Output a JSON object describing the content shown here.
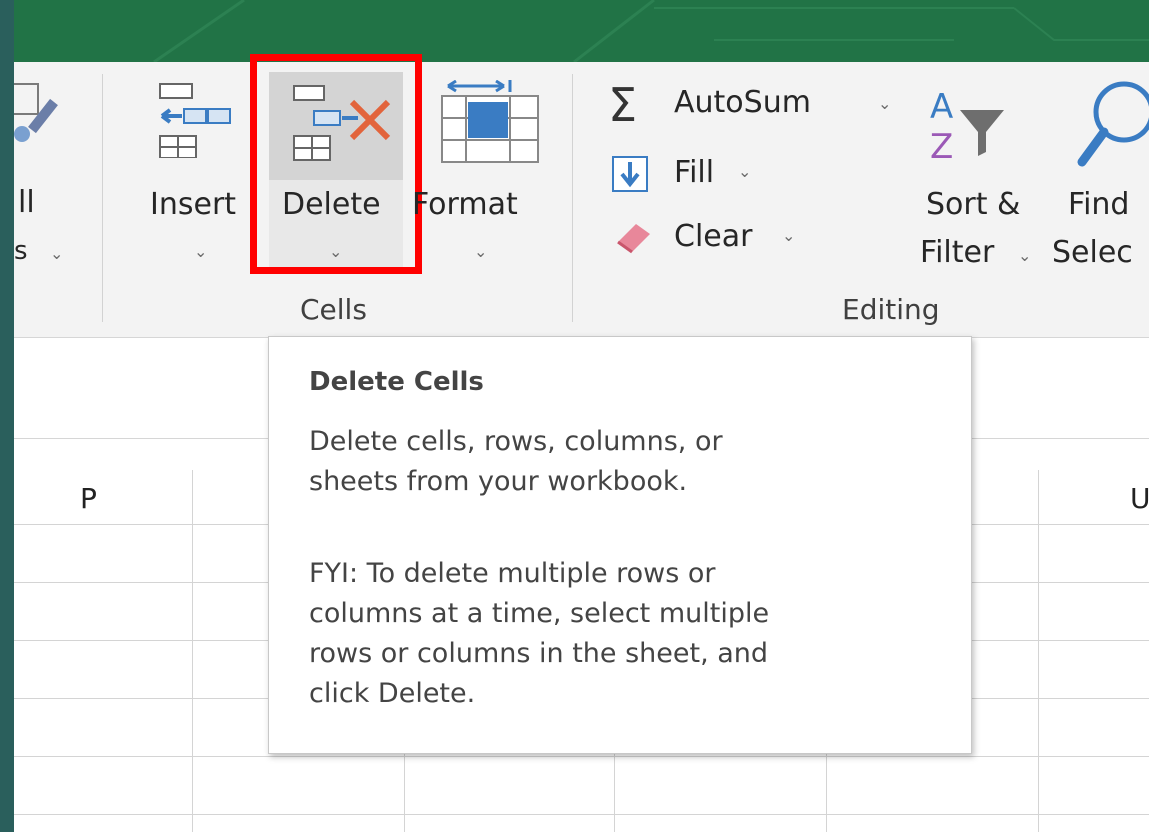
{
  "ribbon": {
    "left_partial": {
      "label_line1": "ll",
      "label_line2": "s"
    },
    "cells_group": {
      "label": "Cells",
      "insert": {
        "label": "Insert"
      },
      "delete": {
        "label": "Delete"
      },
      "format": {
        "label": "Format"
      }
    },
    "editing_group": {
      "label": "Editing",
      "autosum": {
        "label": "AutoSum"
      },
      "fill": {
        "label": "Fill"
      },
      "clear": {
        "label": "Clear"
      },
      "sort_filter": {
        "line1": "Sort &",
        "line2": "Filter"
      },
      "find_select": {
        "line1": "Find",
        "line2": "Selec"
      }
    }
  },
  "grid": {
    "columns": [
      "P",
      "U"
    ]
  },
  "tooltip": {
    "title": "Delete Cells",
    "description_line1": "Delete cells, rows, columns, or",
    "description_line2": "sheets from your workbook.",
    "fyi_line1": "FYI: To delete multiple rows or",
    "fyi_line2": "columns at a time, select multiple",
    "fyi_line3": "rows or columns in the sheet, and",
    "fyi_line4": "click Delete."
  },
  "icons": {
    "insert": "insert-cells-icon",
    "delete": "delete-cells-icon",
    "format": "format-cells-icon",
    "autosum": "sigma-icon",
    "fill": "fill-down-icon",
    "clear": "eraser-icon",
    "sort": "sort-filter-icon",
    "find": "magnifier-icon"
  },
  "colors": {
    "title_bar": "#217346",
    "highlight": "#ff0000",
    "accent_blue": "#3a7cc3",
    "delete_x": "#e2643c"
  }
}
